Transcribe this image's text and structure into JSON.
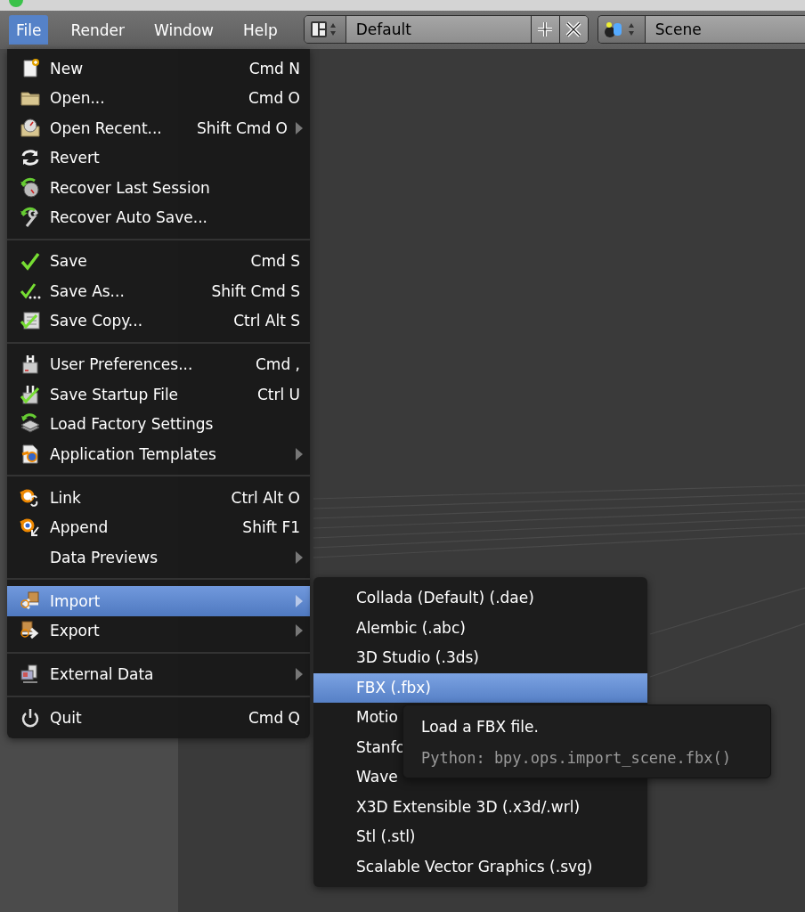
{
  "menubar": [
    {
      "label": "File",
      "selected": true
    },
    {
      "label": "Render",
      "selected": false
    },
    {
      "label": "Window",
      "selected": false
    },
    {
      "label": "Help",
      "selected": false
    }
  ],
  "screen_layout": {
    "value": "Default"
  },
  "scene": {
    "value": "Scene"
  },
  "file_menu": [
    {
      "kind": "item",
      "label": "New",
      "shortcut": "Cmd N",
      "submenu": false,
      "selected": false
    },
    {
      "kind": "item",
      "label": "Open...",
      "shortcut": "Cmd O",
      "submenu": false,
      "selected": false
    },
    {
      "kind": "item",
      "label": "Open Recent...",
      "shortcut": "Shift Cmd O",
      "submenu": true,
      "selected": false
    },
    {
      "kind": "item",
      "label": "Revert",
      "submenu": false,
      "selected": false
    },
    {
      "kind": "item",
      "label": "Recover Last Session",
      "submenu": false,
      "selected": false
    },
    {
      "kind": "item",
      "label": "Recover Auto Save...",
      "submenu": false,
      "selected": false
    },
    {
      "kind": "separator"
    },
    {
      "kind": "item",
      "label": "Save",
      "shortcut": "Cmd S",
      "submenu": false,
      "selected": false
    },
    {
      "kind": "item",
      "label": "Save As...",
      "shortcut": "Shift Cmd S",
      "submenu": false,
      "selected": false
    },
    {
      "kind": "item",
      "label": "Save Copy...",
      "shortcut": "Ctrl Alt S",
      "submenu": false,
      "selected": false
    },
    {
      "kind": "separator"
    },
    {
      "kind": "item",
      "label": "User Preferences...",
      "shortcut": "Cmd ,",
      "submenu": false,
      "selected": false
    },
    {
      "kind": "item",
      "label": "Save Startup File",
      "shortcut": "Ctrl U",
      "submenu": false,
      "selected": false
    },
    {
      "kind": "item",
      "label": "Load Factory Settings",
      "submenu": false,
      "selected": false
    },
    {
      "kind": "item",
      "label": "Application Templates",
      "submenu": true,
      "selected": false
    },
    {
      "kind": "separator"
    },
    {
      "kind": "item",
      "label": "Link",
      "shortcut": "Ctrl Alt O",
      "submenu": false,
      "selected": false
    },
    {
      "kind": "item",
      "label": "Append",
      "shortcut": "Shift F1",
      "submenu": false,
      "selected": false
    },
    {
      "kind": "item",
      "label": "Data Previews",
      "submenu": true,
      "selected": false
    },
    {
      "kind": "separator"
    },
    {
      "kind": "item",
      "label": "Import",
      "submenu": true,
      "selected": true
    },
    {
      "kind": "item",
      "label": "Export",
      "submenu": true,
      "selected": false
    },
    {
      "kind": "separator"
    },
    {
      "kind": "item",
      "label": "External Data",
      "submenu": true,
      "selected": false
    },
    {
      "kind": "separator"
    },
    {
      "kind": "item",
      "label": "Quit",
      "shortcut": "Cmd Q",
      "submenu": false,
      "selected": false
    }
  ],
  "import_menu": [
    {
      "label": "Collada (Default) (.dae)",
      "selected": false
    },
    {
      "label": "Alembic (.abc)",
      "selected": false
    },
    {
      "label": "3D Studio (.3ds)",
      "selected": false
    },
    {
      "label": "FBX (.fbx)",
      "selected": true
    },
    {
      "label": "Motio",
      "selected": false
    },
    {
      "label": "Stanfo",
      "selected": false
    },
    {
      "label": "Wave",
      "selected": false
    },
    {
      "label": "X3D Extensible 3D (.x3d/.wrl)",
      "selected": false
    },
    {
      "label": "Stl (.stl)",
      "selected": false
    },
    {
      "label": "Scalable Vector Graphics (.svg)",
      "selected": false
    }
  ],
  "tooltip": {
    "title": "Load a FBX file.",
    "python": "Python: bpy.ops.import_scene.fbx()"
  }
}
